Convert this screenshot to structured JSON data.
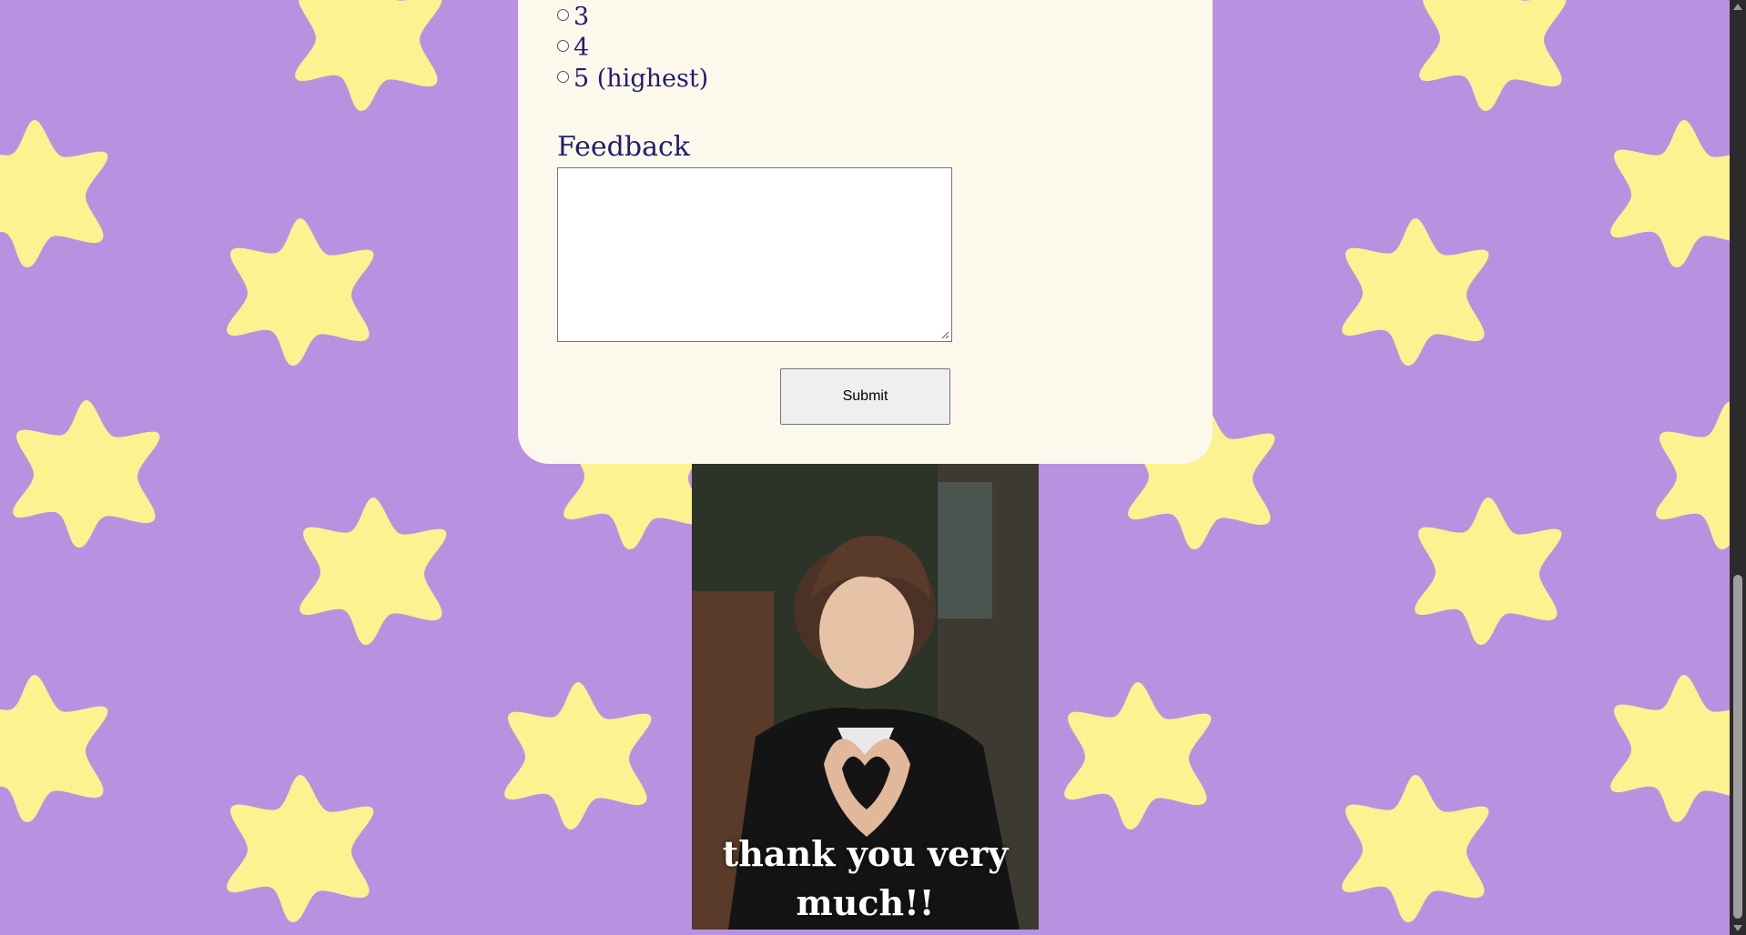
{
  "rating": {
    "options": [
      {
        "label": "3"
      },
      {
        "label": "4"
      },
      {
        "label": "5 (highest)"
      }
    ]
  },
  "feedback": {
    "label": "Feedback",
    "value": ""
  },
  "form": {
    "submit_label": "Submit"
  },
  "photo": {
    "caption": "thank you very much!!"
  },
  "colors": {
    "background": "#b892e0",
    "star": "#fbf290",
    "card": "#fdf8ec",
    "text": "#1e1e6e"
  },
  "icons": {
    "background_pattern": "star-icon",
    "resize": "resize-grip-icon"
  }
}
